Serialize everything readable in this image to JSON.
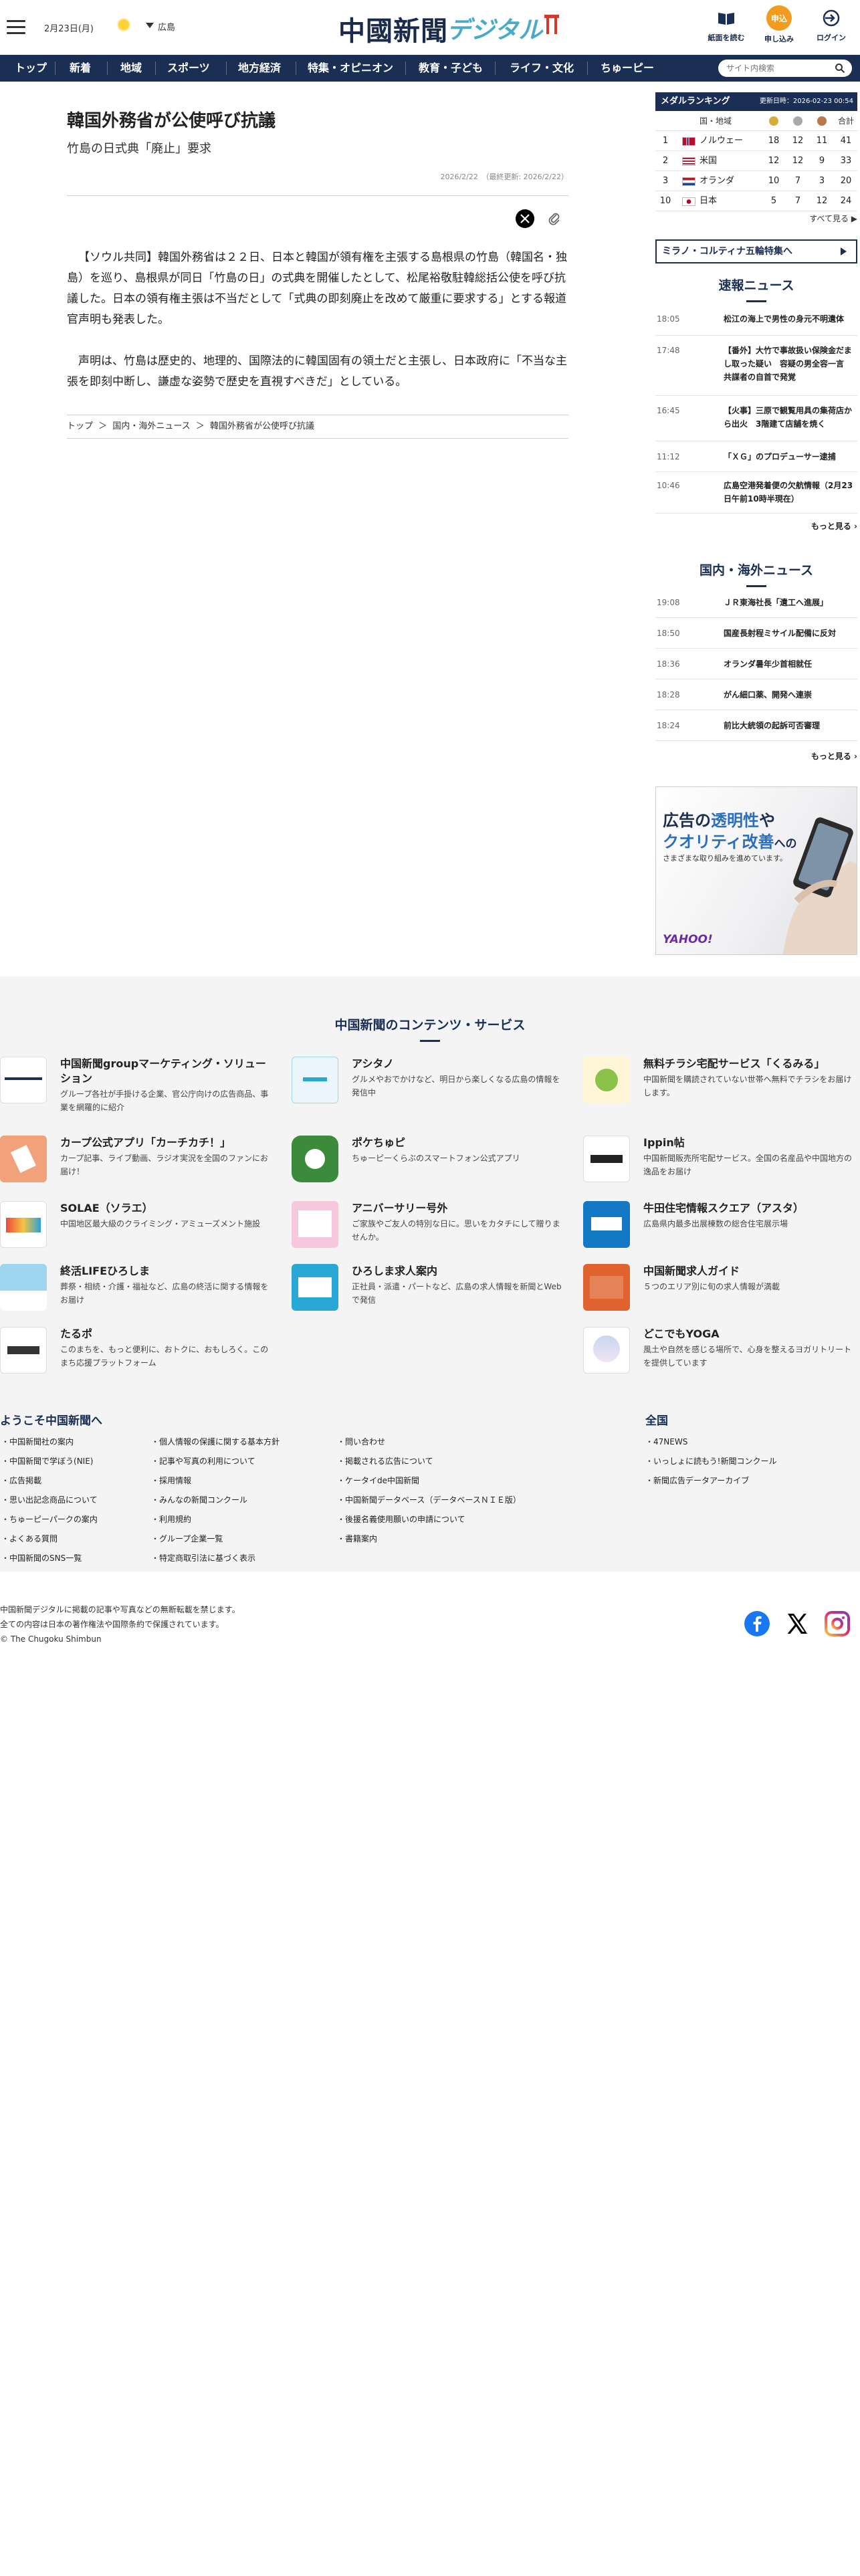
{
  "header": {
    "date": "2月23日(月)",
    "weather_icon": "sun-icon",
    "ad_label": "広島",
    "logo_main": "中國新聞",
    "logo_sub": "デジタル",
    "icons": [
      {
        "label": "紙面を読む",
        "icon": "newspaper-icon"
      },
      {
        "label": "申し込み",
        "icon": "signup-icon",
        "circle_text": "申込"
      },
      {
        "label": "ログイン",
        "icon": "login-icon"
      }
    ]
  },
  "nav": {
    "items": [
      "トップ",
      "新着",
      "地域",
      "スポーツ",
      "地方経済",
      "特集・オピニオン",
      "教育・子ども",
      "ライフ・文化",
      "ちゅーピー"
    ],
    "search_placeholder": "サイト内検索"
  },
  "article": {
    "title": "韓国外務省が公使呼び抗議",
    "subtitle": "竹島の日式典「廃止」要求",
    "date": "2026/2/22　（最終更新: 2026/2/22）",
    "paragraphs": [
      "【ソウル共同】韓国外務省は２２日、日本と韓国が領有権を主張する島根県の竹島（韓国名・独島）を巡り、島根県が同日「竹島の日」の式典を開催したとして、松尾裕敬駐韓総括公使を呼び抗議した。日本の領有権主張は不当だとして「式典の即刻廃止を改めて厳重に要求する」とする報道官声明も発表した。",
      "声明は、竹島は歴史的、地理的、国際法的に韓国固有の領土だと主張し、日本政府に「不当な主張を即刻中断し、謙虚な姿勢で歴史を直視すべきだ」としている。"
    ],
    "breadcrumb": [
      "トップ",
      "＞",
      "国内・海外ニュース",
      "＞",
      "韓国外務省が公使呼び抗議"
    ]
  },
  "medal": {
    "title": "メダルランキング",
    "updated": "更新日時：2026-02-23 00:54",
    "col_country": "国・地域",
    "col_total": "合計",
    "rows": [
      {
        "rank": "1",
        "country": "ノルウェー",
        "gold": "18",
        "silver": "12",
        "bronze": "11",
        "total": "41"
      },
      {
        "rank": "2",
        "country": "米国",
        "gold": "12",
        "silver": "12",
        "bronze": "9",
        "total": "33"
      },
      {
        "rank": "3",
        "country": "オランダ",
        "gold": "10",
        "silver": "7",
        "bronze": "3",
        "total": "20"
      },
      {
        "rank": "10",
        "country": "日本",
        "gold": "5",
        "silver": "7",
        "bronze": "12",
        "total": "24"
      }
    ],
    "more": "すべて見る ▶",
    "feature": "ミラノ・コルティナ五輪特集へ"
  },
  "flash": {
    "title": "速報ニュース",
    "items": [
      {
        "time": "18:05",
        "text": "松江の海上で男性の身元不明遺体"
      },
      {
        "time": "17:48",
        "text": "【番外】大竹で事故扱い保険金だまし取った疑い　容疑の男全容一言　共謀者の自首で発覚"
      },
      {
        "time": "16:45",
        "text": "【火事】三原で観覧用具の集荷店から出火　3階建て店舗を焼く"
      },
      {
        "time": "11:12",
        "text": "「ＸＧ」のプロデューサー逮捕"
      },
      {
        "time": "10:46",
        "text": "広島空港発着便の欠航情報（2月23日午前10時半現在）"
      }
    ],
    "more": "もっと見る"
  },
  "world": {
    "title": "国内・海外ニュース",
    "items": [
      {
        "time": "19:08",
        "text": "ＪＲ東海社長「遺工へ進展」"
      },
      {
        "time": "18:50",
        "text": "国産長射程ミサイル配備に反対"
      },
      {
        "time": "18:36",
        "text": "オランダ暑年少首相就任"
      },
      {
        "time": "18:28",
        "text": "がん細口薬、開発へ連崇"
      },
      {
        "time": "18:24",
        "text": "前比大統領の起訴可否審理"
      }
    ],
    "more": "もっと見る"
  },
  "ad": {
    "line1_pre": "広告の",
    "line1_em": "透明性",
    "line1_post": "や",
    "line2_em": "クオリティ改善",
    "line2_post": "への",
    "line3": "さまざまな取り組みを進めています。",
    "brand": "YAHOO!"
  },
  "services": {
    "title": "中国新聞のコンテンツ・サービス",
    "items": [
      {
        "name": "中国新聞groupマーケティング・ソリューション",
        "desc": "グループ各社が手掛ける企業、官公庁向けの広告商品、事業を網羅的に紹介",
        "color": "#ffffff"
      },
      {
        "name": "アシタノ",
        "desc": "グルメやおでかけなど、明日から楽しくなる広島の情報を発信中",
        "color": "#eaf6fb"
      },
      {
        "name": "無料チラシ宅配サービス「くるみる」",
        "desc": "中国新聞を購読されていない世帯へ無料でチラシをお届けします。",
        "color": "#fff6d8"
      },
      {
        "name": "カープ公式アプリ「カーチカチ！」",
        "desc": "カープ記事、ライブ動画、ラジオ実況を全国のファンにお届け！",
        "color": "#f2a27a"
      },
      {
        "name": "ポケちゅピ",
        "desc": "ちゅーピーくらぶのスマートフォン公式アプリ",
        "color": "#3c8a3c"
      },
      {
        "name": "Ippin帖",
        "desc": "中国新聞販売所宅配サービス。全国の名産品や中国地方の逸品をお届け",
        "color": "#ffffff"
      },
      {
        "name": "SOLAE（ソラエ）",
        "desc": "中国地区最大級のクライミング・アミューズメント施設",
        "color": "#ffffff"
      },
      {
        "name": "アニバーサリー号外",
        "desc": "ご家族やご友人の特別な日に。思いをカタチにして贈りませんか。",
        "color": "#f7c7dd"
      },
      {
        "name": "牛田住宅情報スクエア（アスタ）",
        "desc": "広島県内最多出展棟数の総合住宅展示場",
        "color": "#1479c4"
      },
      {
        "name": "終活LIFEひろしま",
        "desc": "葬祭・相続・介護・福祉など、広島の終活に関する情報をお届け",
        "color": "#9fd6ef"
      },
      {
        "name": "ひろしま求人案内",
        "desc": "正社員・派遣・パートなど、広島の求人情報を新聞とWebで発信",
        "color": "#29a8d6"
      },
      {
        "name": "中国新聞求人ガイド",
        "desc": "５つのエリア別に旬の求人情報が満載",
        "color": "#e0632f"
      },
      {
        "name": "たるポ",
        "desc": "このまちを、もっと便利に、おトクに、おもしろく。このまち応援プラットフォーム",
        "color": "#ffffff"
      },
      {
        "name": "",
        "desc": "",
        "color": ""
      },
      {
        "name": "どこでもYOGA",
        "desc": "風土や自然を感じる場所で、心身を整えるヨガリトリートを提供しています",
        "color": "#ffffff"
      }
    ]
  },
  "welcome": {
    "title": "ようこそ中国新聞へ",
    "col1": [
      "中国新聞社の案内",
      "中国新聞で学ぼう(NIE)",
      "広告掲載",
      "思い出記念商品について",
      "ちゅーピーパークの案内",
      "よくある質問",
      "中国新聞のSNS一覧"
    ],
    "col2": [
      "個人情報の保護に関する基本方針",
      "記事や写真の利用について",
      "採用情報",
      "みんなの新聞コンクール",
      "利用規約",
      "グループ企業一覧",
      "特定商取引法に基づく表示"
    ],
    "col3": [
      "問い合わせ",
      "掲載される広告について",
      "ケータイde中国新聞",
      "中国新聞データベース（データベースＮＩＥ版）",
      "後援名義使用願いの申請について",
      "書籍案内"
    ]
  },
  "zenkoku": {
    "title": "全国",
    "links": [
      "47NEWS",
      "いっしょに読もう!新聞コンクール",
      "新聞広告データアーカイブ"
    ]
  },
  "footer": {
    "lines": [
      "中国新聞デジタルに掲載の記事や写真などの無断転載を禁じます。",
      "全ての内容は日本の著作権法や国際条約で保護されています。",
      "© The Chugoku Shimbun"
    ],
    "social": [
      "facebook-icon",
      "x-icon",
      "instagram-icon"
    ]
  }
}
